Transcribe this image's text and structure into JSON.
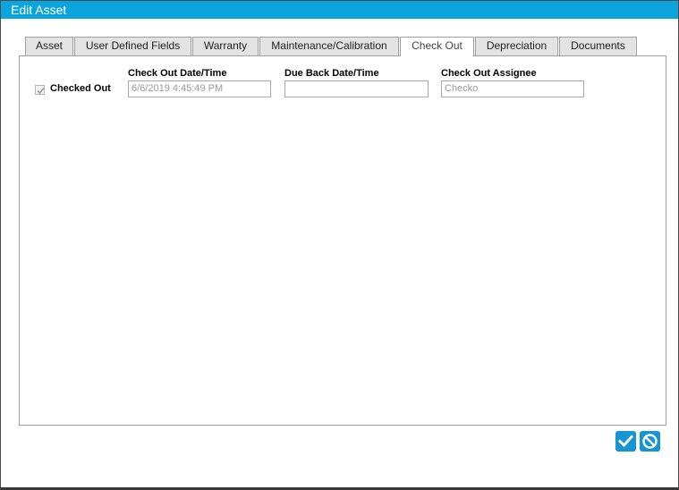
{
  "window": {
    "title": "Edit Asset"
  },
  "tabs": [
    {
      "label": "Asset",
      "active": false
    },
    {
      "label": "User Defined Fields",
      "active": false
    },
    {
      "label": "Warranty",
      "active": false
    },
    {
      "label": "Maintenance/Calibration",
      "active": false
    },
    {
      "label": "Check Out",
      "active": true
    },
    {
      "label": "Depreciation",
      "active": false
    },
    {
      "label": "Documents",
      "active": false
    }
  ],
  "checkout": {
    "checked_out_label": "Checked Out",
    "checked_out": true,
    "checkout_datetime_label": "Check Out Date/Time",
    "checkout_datetime_value": "6/6/2019 4:45:49 PM",
    "due_back_label": "Due Back Date/Time",
    "due_back_value": "",
    "assignee_label": "Check Out Assignee",
    "assignee_value": "Checko"
  },
  "actions": {
    "save_icon": "checkmark-icon",
    "cancel_icon": "cancel-icon",
    "accent_color": "#1596d3"
  },
  "colors": {
    "titlebar": "#0ba4dc"
  }
}
